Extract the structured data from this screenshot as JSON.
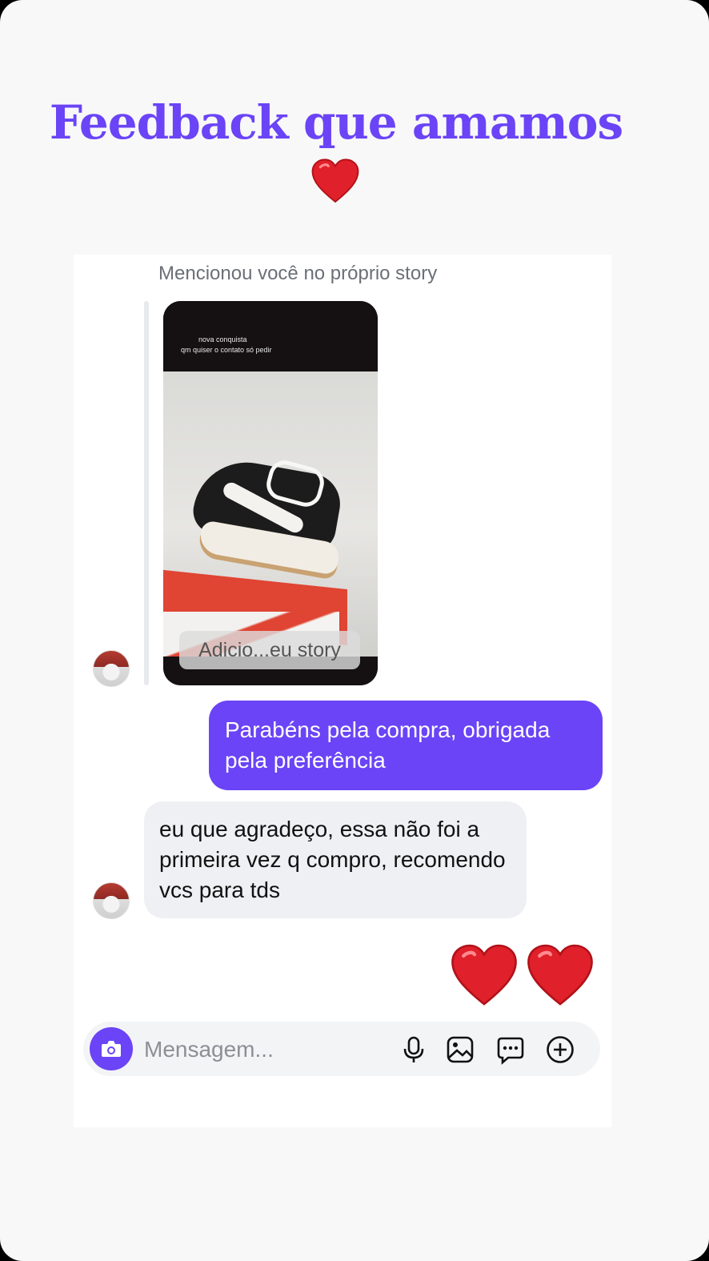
{
  "header": {
    "title": "Feedback que amamos"
  },
  "thread": {
    "mention_label": "Mencionou você no próprio story",
    "story": {
      "caption_line1": "nova conquista",
      "caption_line2": "qm quiser o contato só pedir",
      "add_button": "Adicio...eu story"
    },
    "messages": [
      {
        "from": "me",
        "text": "Parabéns pela compra, obrigada pela preferência"
      },
      {
        "from": "them",
        "text": "eu que agradeço, essa não foi a primeira vez q compro, recomendo vcs para tds"
      }
    ],
    "reaction_icons": [
      "heart-icon",
      "heart-icon"
    ]
  },
  "composer": {
    "placeholder": "Mensagem...",
    "icons": [
      "camera-icon",
      "microphone-icon",
      "gallery-icon",
      "sticker-icon",
      "plus-icon"
    ]
  },
  "colors": {
    "accent": "#6a44f6",
    "heart": "#e0202a",
    "incoming_bubble": "#eff0f3",
    "background": "#f8f8f9"
  }
}
